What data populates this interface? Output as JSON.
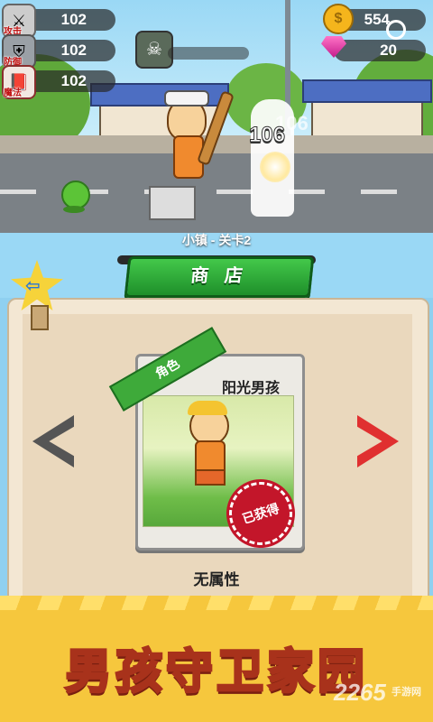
{
  "stats": [
    {
      "label": "攻击",
      "value": "102",
      "icon": "sword-icon"
    },
    {
      "label": "防御",
      "value": "102",
      "icon": "shield-icon"
    },
    {
      "label": "魔法",
      "value": "102",
      "icon": "magic-book-icon"
    }
  ],
  "currency": {
    "coins": "554",
    "gems": "20"
  },
  "combat": {
    "damage_number": "106",
    "damage_shadow": "106"
  },
  "level_label": "小镇 - 关卡2",
  "shop_button": "商 店",
  "card": {
    "tag": "角色",
    "name": "阳光男孩",
    "stamp": "已获得"
  },
  "attribute_text": "无属性",
  "banner_title": "男孩守卫家园",
  "watermark": {
    "brand": "2265",
    "suffix": "手游网"
  },
  "colors": {
    "accent_green": "#2fae3a",
    "nav_red": "#e03030",
    "banner_yellow": "#f6c73d"
  }
}
